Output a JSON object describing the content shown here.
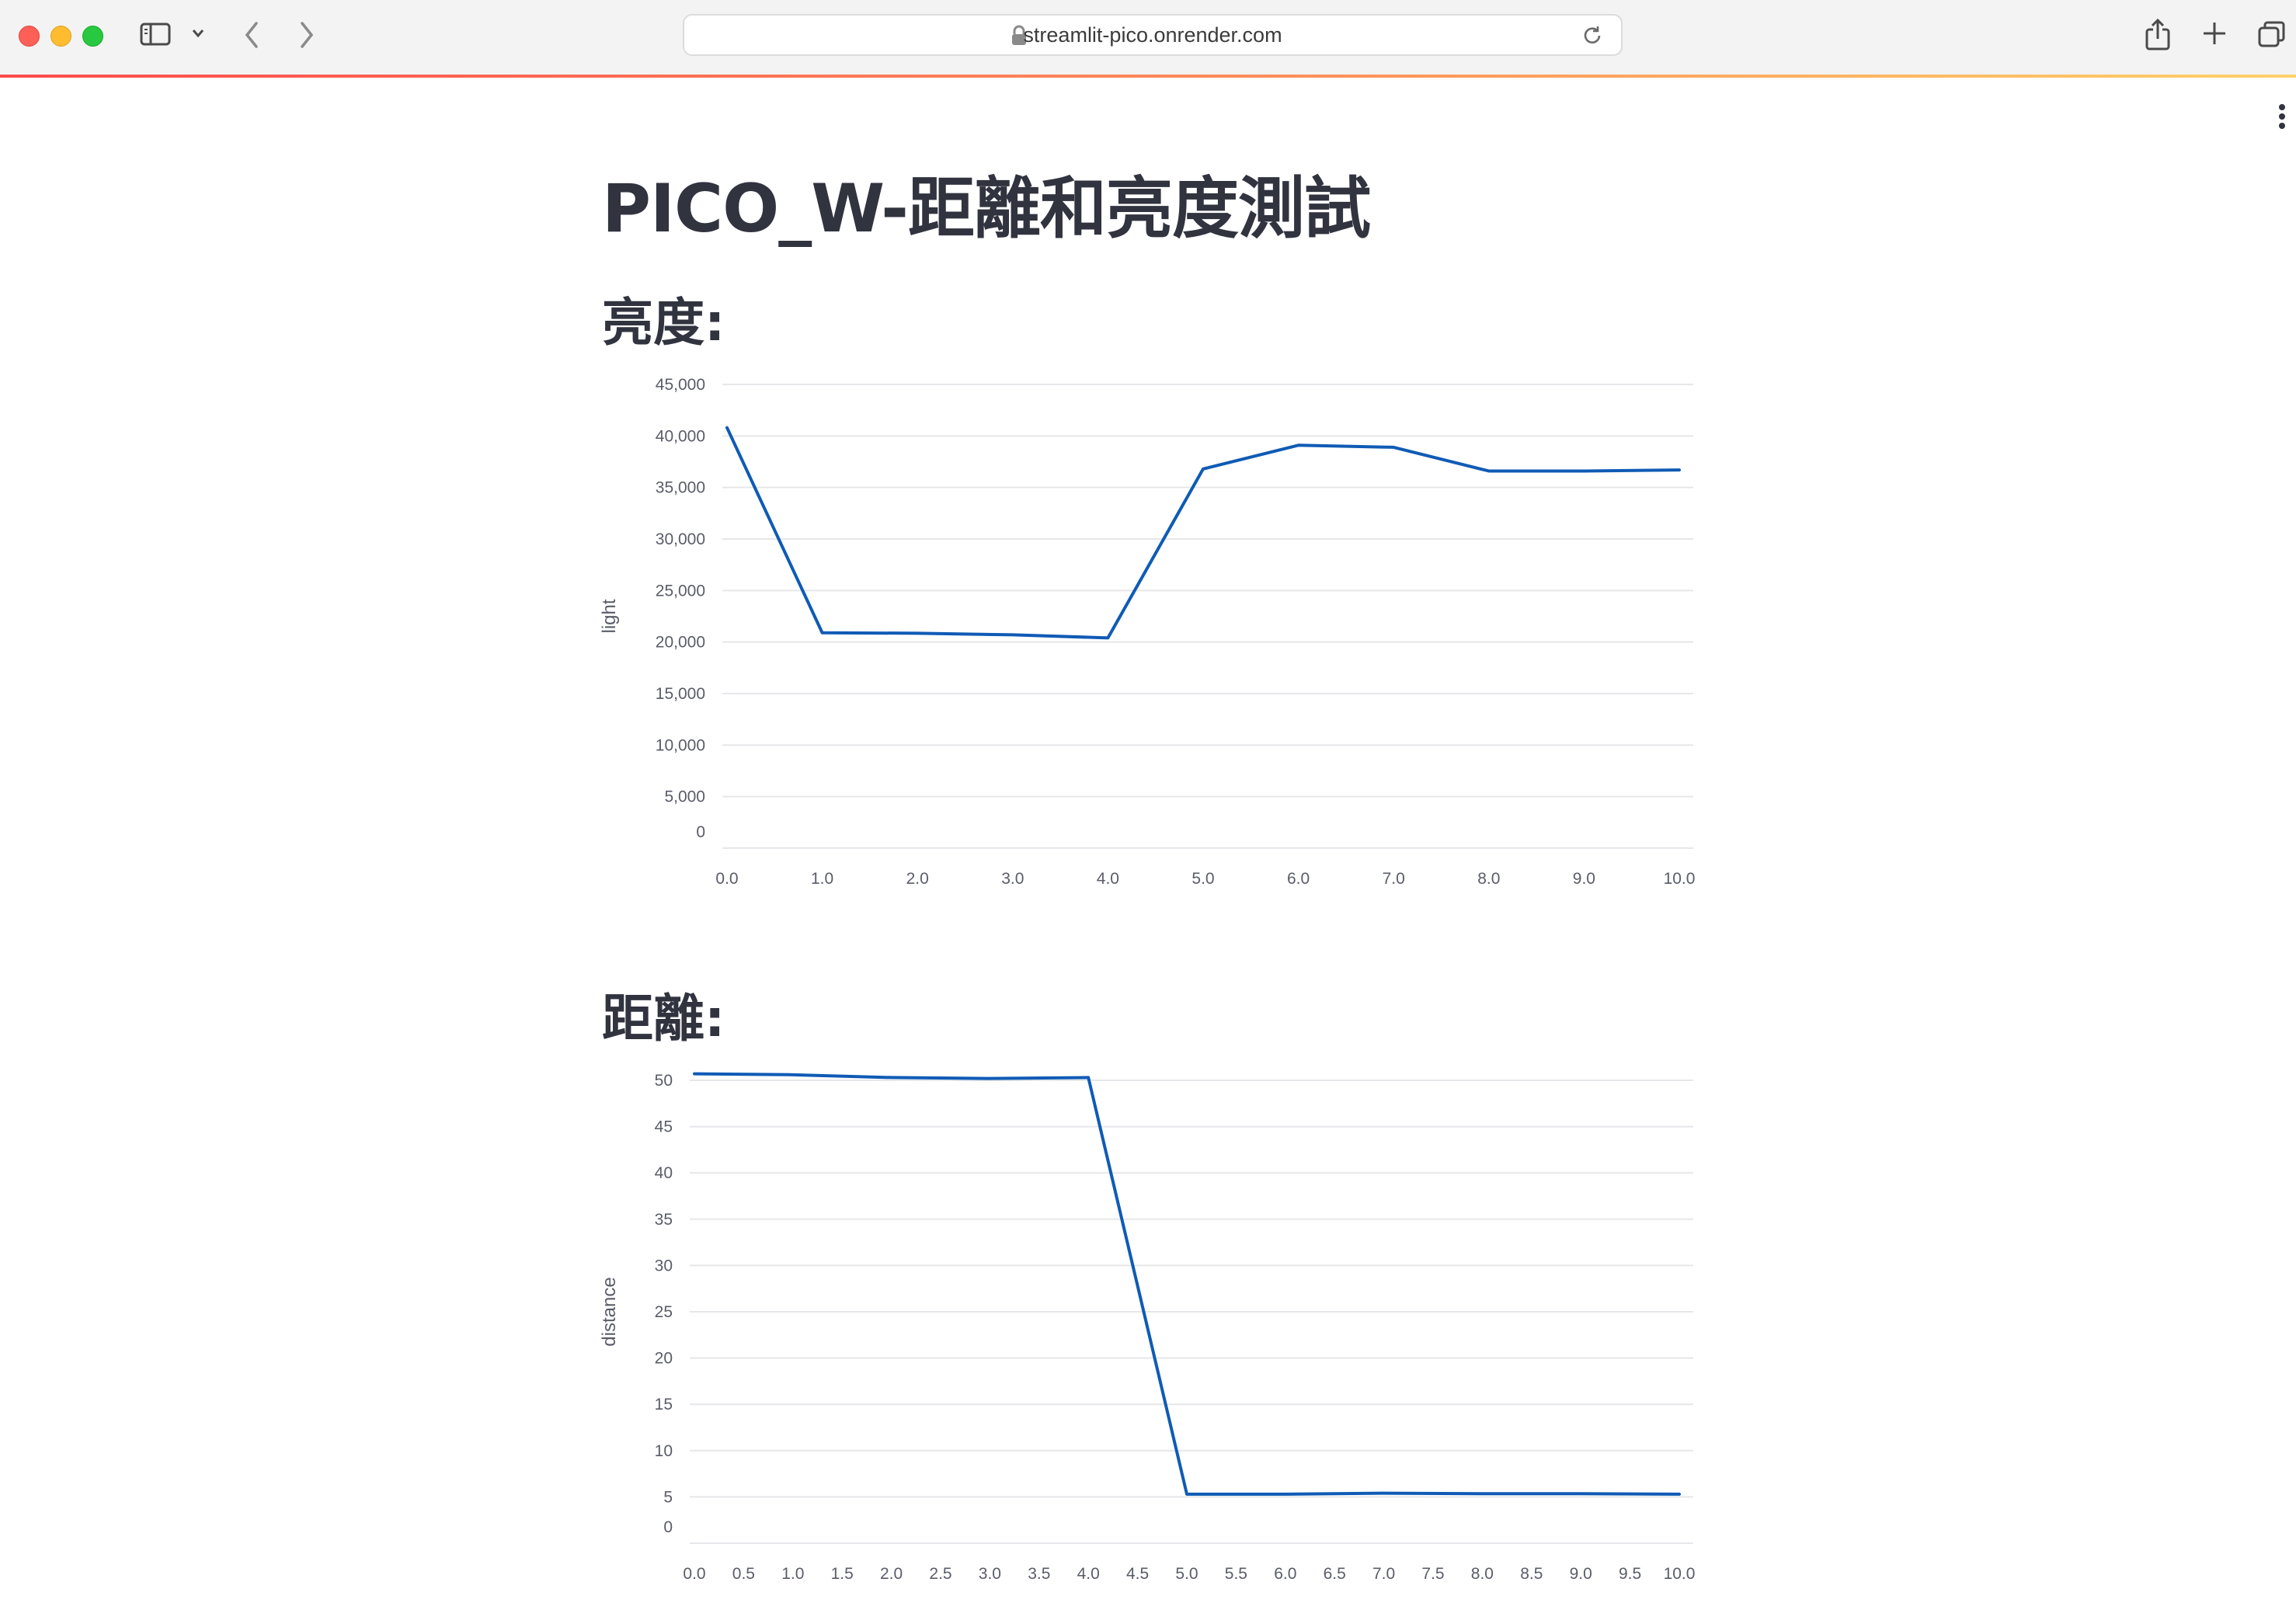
{
  "browser": {
    "url": "streamlit-pico.onrender.com",
    "colors": {
      "close": "#fe5f57",
      "minimize": "#febc2e",
      "maximize": "#28c840"
    },
    "icons": [
      "sidebar-icon",
      "chevron-down-icon",
      "back-icon",
      "forward-icon",
      "lock-icon",
      "reload-icon",
      "share-icon",
      "new-tab-icon",
      "tab-overview-icon",
      "more-icon"
    ]
  },
  "page": {
    "title": "PICO_W-距離和亮度測試",
    "light_heading": "亮度:",
    "distance_heading": "距離:"
  },
  "chart_data": [
    {
      "type": "line",
      "ylabel": "light",
      "xlabel": "",
      "x_tick_labels": [
        "0.0",
        "1.0",
        "2.0",
        "3.0",
        "4.0",
        "5.0",
        "6.0",
        "7.0",
        "8.0",
        "9.0",
        "10.0"
      ],
      "y_tick_labels": [
        "0",
        "5,000",
        "10,000",
        "15,000",
        "20,000",
        "25,000",
        "30,000",
        "35,000",
        "40,000",
        "45,000"
      ],
      "xlim": [
        0,
        10
      ],
      "ylim": [
        0,
        45000
      ],
      "grid": true,
      "color": "#0f5bb5",
      "x": [
        0,
        1,
        2,
        3,
        4,
        5,
        6,
        7,
        8,
        9,
        10
      ],
      "y": [
        40800,
        20900,
        20850,
        20700,
        20400,
        36800,
        39100,
        38900,
        36600,
        36600,
        36700
      ]
    },
    {
      "type": "line",
      "ylabel": "distance",
      "xlabel": "",
      "x_tick_labels": [
        "0.0",
        "0.5",
        "1.0",
        "1.5",
        "2.0",
        "2.5",
        "3.0",
        "3.5",
        "4.0",
        "4.5",
        "5.0",
        "5.5",
        "6.0",
        "6.5",
        "7.0",
        "7.5",
        "8.0",
        "8.5",
        "9.0",
        "9.5",
        "10.0"
      ],
      "y_tick_labels": [
        "0",
        "5",
        "10",
        "15",
        "20",
        "25",
        "30",
        "35",
        "40",
        "45",
        "50"
      ],
      "xlim": [
        0,
        10
      ],
      "ylim": [
        0,
        50
      ],
      "grid": true,
      "color": "#0f5bb5",
      "x": [
        0,
        1,
        2,
        3,
        4,
        5,
        6,
        7,
        8,
        9,
        10
      ],
      "y": [
        50.7,
        50.6,
        50.3,
        50.2,
        50.3,
        5.3,
        5.3,
        5.4,
        5.35,
        5.35,
        5.3
      ]
    }
  ]
}
